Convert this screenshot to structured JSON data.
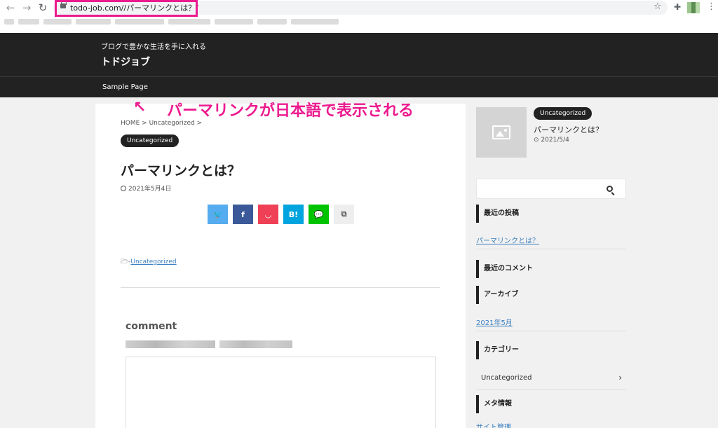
{
  "browser": {
    "url": "todo-job.com//パーマリンクとは？/",
    "back_glyph": "←",
    "forward_glyph": "→",
    "reload_glyph": "↻",
    "star_glyph": "☆",
    "extensions_glyph": "✚",
    "menu_glyph": "⋮",
    "highlight_color": "#ec1a8f"
  },
  "site": {
    "tagline": "ブログで豊かな生活を手に入れる",
    "title": "トドジョブ",
    "nav": [
      "Sample Page"
    ]
  },
  "annotation": {
    "arrow": "↖",
    "text": "パーマリンクが日本語で表示される"
  },
  "article": {
    "breadcrumb": "HOME > Uncategorized >",
    "category_chip": "Uncategorized",
    "title": "パーマリンクとは？",
    "date": "2021年5月4日",
    "share_buttons": [
      {
        "icon": "twitter-icon",
        "glyph": "🐦",
        "color": "#55acee"
      },
      {
        "icon": "facebook-icon",
        "glyph": "f",
        "color": "#3b5998"
      },
      {
        "icon": "pocket-icon",
        "glyph": "◡",
        "color": "#ef4056"
      },
      {
        "icon": "hatena-icon",
        "glyph": "B!",
        "color": "#00a4de"
      },
      {
        "icon": "line-icon",
        "glyph": "💬",
        "color": "#00c300"
      },
      {
        "icon": "copy-icon",
        "glyph": "⧉",
        "color": "#eeeeee"
      }
    ],
    "category_prefix": "🗁-",
    "category_link": "Uncategorized",
    "comment_heading": "comment"
  },
  "sidebar": {
    "popular_post": {
      "category": "Uncategorized",
      "title": "パーマリンクとは？",
      "date": "2021/5/4",
      "clock_glyph": "⊙"
    },
    "widgets": {
      "recent_posts": "最近の投稿",
      "recent_posts_link": "パーマリンクとは？",
      "recent_comments": "最近のコメント",
      "archives": "アーカイブ",
      "archives_link": "2021年5月",
      "categories": "カテゴリー",
      "categories_item": "Uncategorized",
      "meta": "メタ情報",
      "meta_link": "サイト管理"
    },
    "chevron_glyph": "›"
  }
}
